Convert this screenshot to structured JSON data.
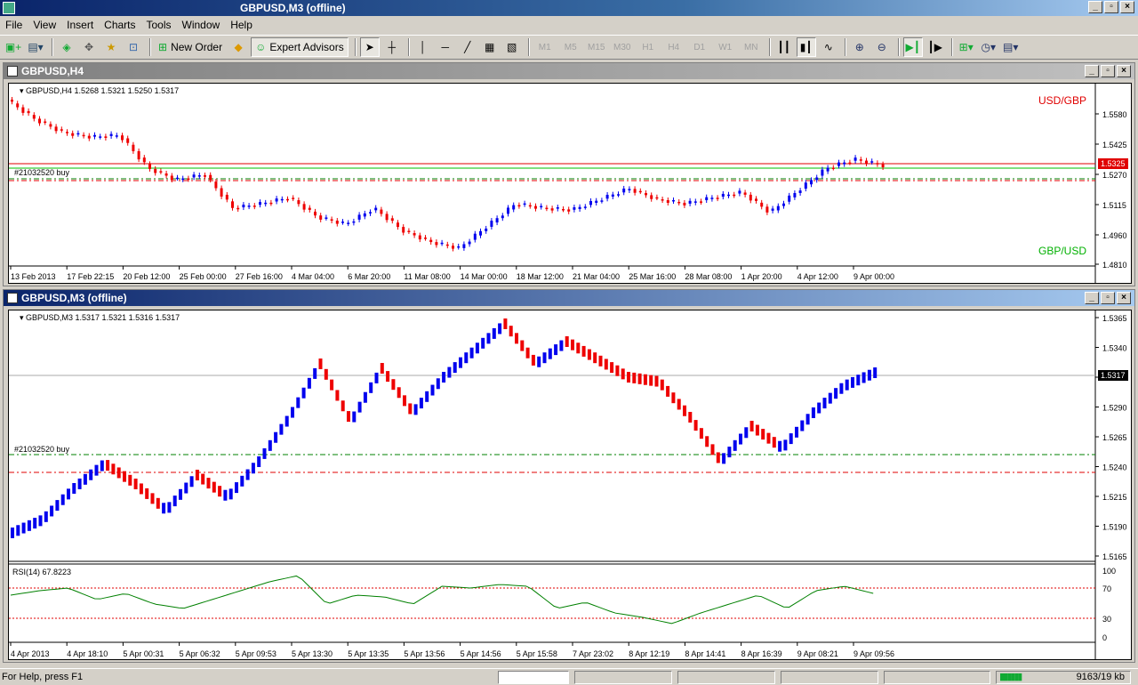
{
  "app": {
    "title": "GBPUSD,M3 (offline)",
    "window_controls": [
      "_",
      "▫",
      "×"
    ]
  },
  "menu": [
    "File",
    "View",
    "Insert",
    "Charts",
    "Tools",
    "Window",
    "Help"
  ],
  "toolbar": {
    "new_order_label": "New Order",
    "expert_advisors_label": "Expert Advisors",
    "timeframes": [
      "M1",
      "M5",
      "M15",
      "M30",
      "H1",
      "H4",
      "D1",
      "W1",
      "MN"
    ]
  },
  "chart_h4": {
    "window_title": "GBPUSD,H4",
    "info": "GBPUSD,H4  1.5268 1.5321 1.5250 1.5317",
    "order_label": "#21032520 buy",
    "label_top": "USD/GBP",
    "label_bottom": "GBP/USD",
    "price_ticks": [
      "1.5580",
      "1.5425",
      "1.5270",
      "1.5115",
      "1.4960",
      "1.4810"
    ],
    "current_price": "1.5325",
    "time_ticks": [
      "13 Feb 2013",
      "17 Feb 22:15",
      "20 Feb 12:00",
      "25 Feb 00:00",
      "27 Feb 16:00",
      "4 Mar 04:00",
      "6 Mar 20:00",
      "11 Mar 08:00",
      "14 Mar 00:00",
      "18 Mar 12:00",
      "21 Mar 04:00",
      "25 Mar 16:00",
      "28 Mar 08:00",
      "1 Apr 20:00",
      "4 Apr 12:00",
      "9 Apr 00:00"
    ],
    "colors": {
      "up": "#0000ee",
      "down": "#ee0000",
      "label_top": "#e00000",
      "label_bottom": "#00b000"
    }
  },
  "chart_m3": {
    "window_title": "GBPUSD,M3 (offline)",
    "info": "GBPUSD,M3  1.5317 1.5321 1.5316 1.5317",
    "order_label": "#21032520 buy",
    "price_ticks": [
      "1.5365",
      "1.5340",
      "1.5315",
      "1.5290",
      "1.5265",
      "1.5240",
      "1.5215",
      "1.5190",
      "1.5165"
    ],
    "current_price": "1.5317",
    "rsi_label": "RSI(14) 67.8223",
    "rsi_ticks": [
      "100",
      "70",
      "30",
      "0"
    ],
    "time_ticks": [
      "4 Apr 2013",
      "4 Apr 18:10",
      "5 Apr 00:31",
      "5 Apr 06:32",
      "5 Apr 09:53",
      "5 Apr 13:30",
      "5 Apr 13:35",
      "5 Apr 13:56",
      "5 Apr 14:56",
      "5 Apr 15:58",
      "7 Apr 23:02",
      "8 Apr 12:19",
      "8 Apr 14:41",
      "8 Apr 16:39",
      "9 Apr 08:21",
      "9 Apr 09:56"
    ]
  },
  "status": {
    "help_text": "For Help, press F1",
    "traffic": "9163/19 kb"
  }
}
